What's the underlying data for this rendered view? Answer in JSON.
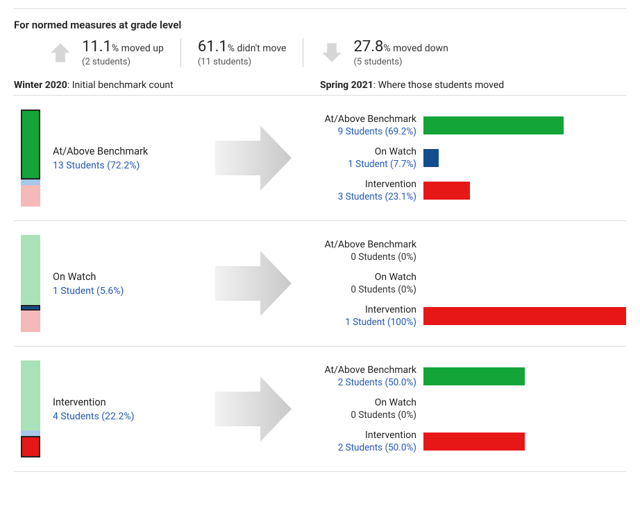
{
  "title": "For normed measures at grade level",
  "summary": {
    "up": {
      "pct": "11.1",
      "suffix": "% moved up",
      "detail": "(2 students)"
    },
    "stay": {
      "pct": "61.1",
      "suffix": "% didn't move",
      "detail": "(11 students)"
    },
    "down": {
      "pct": "27.8",
      "suffix": "% moved down",
      "detail": "(5 students)"
    }
  },
  "headerLeft": {
    "period": "Winter 2020",
    "desc": ": Initial benchmark count"
  },
  "headerRight": {
    "period": "Spring 2021",
    "desc": ": Where those students moved"
  },
  "colors": {
    "benchmark": "#13a538",
    "benchmarkLight": "#a9e2b8",
    "onwatch": "#124d8e",
    "onwatchLight": "#a7c8e8",
    "intervention": "#e81717",
    "interventionLight": "#f6b9b9",
    "arrowGrey": "#cfcfcf"
  },
  "groups": [
    {
      "label": "At/Above Benchmark",
      "countText": "13 Students (72.2%)",
      "highlight": "benchmark",
      "vbar": [
        {
          "colorKey": "benchmark",
          "pct": 72.2,
          "border": true
        },
        {
          "colorKey": "onwatchLight",
          "pct": 5.6
        },
        {
          "colorKey": "interventionLight",
          "pct": 22.2
        }
      ],
      "dest": [
        {
          "cat": "At/Above Benchmark",
          "text": "9 Students (69.2%)",
          "pct": 69.2,
          "colorKey": "benchmark",
          "link": true
        },
        {
          "cat": "On Watch",
          "text": "1 Student (7.7%)",
          "pct": 7.7,
          "colorKey": "onwatch",
          "link": true
        },
        {
          "cat": "Intervention",
          "text": "3 Students (23.1%)",
          "pct": 23.1,
          "colorKey": "intervention",
          "link": true
        }
      ]
    },
    {
      "label": "On Watch",
      "countText": "1 Student (5.6%)",
      "highlight": "onwatch",
      "vbar": [
        {
          "colorKey": "benchmarkLight",
          "pct": 72.2
        },
        {
          "colorKey": "onwatch",
          "pct": 5.6,
          "border": true
        },
        {
          "colorKey": "interventionLight",
          "pct": 22.2
        }
      ],
      "dest": [
        {
          "cat": "At/Above Benchmark",
          "text": "0 Students (0%)",
          "pct": 0,
          "colorKey": "benchmark",
          "link": false
        },
        {
          "cat": "On Watch",
          "text": "0 Students (0%)",
          "pct": 0,
          "colorKey": "onwatch",
          "link": false
        },
        {
          "cat": "Intervention",
          "text": "1 Student (100%)",
          "pct": 100,
          "colorKey": "intervention",
          "link": true
        }
      ]
    },
    {
      "label": "Intervention",
      "countText": "4 Students (22.2%)",
      "highlight": "intervention",
      "vbar": [
        {
          "colorKey": "benchmarkLight",
          "pct": 72.2
        },
        {
          "colorKey": "onwatchLight",
          "pct": 5.6
        },
        {
          "colorKey": "intervention",
          "pct": 22.2,
          "border": true
        }
      ],
      "dest": [
        {
          "cat": "At/Above Benchmark",
          "text": "2 Students (50.0%)",
          "pct": 50.0,
          "colorKey": "benchmark",
          "link": true
        },
        {
          "cat": "On Watch",
          "text": "0 Students (0%)",
          "pct": 0,
          "colorKey": "onwatch",
          "link": false
        },
        {
          "cat": "Intervention",
          "text": "2 Students (50.0%)",
          "pct": 50.0,
          "colorKey": "intervention",
          "link": true
        }
      ]
    }
  ],
  "chart_data": {
    "type": "bar",
    "title": "Student benchmark movement (Winter 2020 → Spring 2021)",
    "initial_distribution": {
      "At/Above Benchmark": {
        "students": 13,
        "pct": 72.2
      },
      "On Watch": {
        "students": 1,
        "pct": 5.6
      },
      "Intervention": {
        "students": 4,
        "pct": 22.2
      }
    },
    "movement_summary": {
      "moved_up": {
        "students": 2,
        "pct": 11.1
      },
      "didnt_move": {
        "students": 11,
        "pct": 61.1
      },
      "moved_down": {
        "students": 5,
        "pct": 27.8
      }
    },
    "transitions": [
      {
        "from": "At/Above Benchmark",
        "to": "At/Above Benchmark",
        "students": 9,
        "pct": 69.2
      },
      {
        "from": "At/Above Benchmark",
        "to": "On Watch",
        "students": 1,
        "pct": 7.7
      },
      {
        "from": "At/Above Benchmark",
        "to": "Intervention",
        "students": 3,
        "pct": 23.1
      },
      {
        "from": "On Watch",
        "to": "At/Above Benchmark",
        "students": 0,
        "pct": 0
      },
      {
        "from": "On Watch",
        "to": "On Watch",
        "students": 0,
        "pct": 0
      },
      {
        "from": "On Watch",
        "to": "Intervention",
        "students": 1,
        "pct": 100
      },
      {
        "from": "Intervention",
        "to": "At/Above Benchmark",
        "students": 2,
        "pct": 50.0
      },
      {
        "from": "Intervention",
        "to": "On Watch",
        "students": 0,
        "pct": 0
      },
      {
        "from": "Intervention",
        "to": "Intervention",
        "students": 2,
        "pct": 50.0
      }
    ]
  }
}
